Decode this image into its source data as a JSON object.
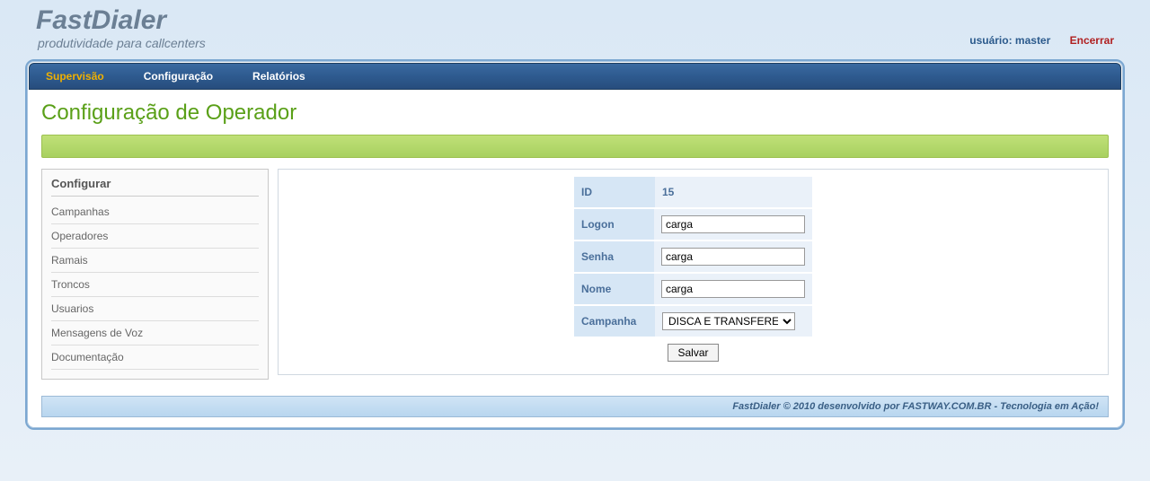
{
  "brand": {
    "title": "FastDialer",
    "subtitle": "produtividade para callcenters"
  },
  "topRight": {
    "userLabel": "usuário: master",
    "logout": "Encerrar"
  },
  "nav": {
    "items": [
      {
        "label": "Supervisão",
        "active": true
      },
      {
        "label": "Configuração",
        "active": false
      },
      {
        "label": "Relatórios",
        "active": false
      }
    ]
  },
  "pageTitle": "Configuração de Operador",
  "sidebar": {
    "heading": "Configurar",
    "items": [
      "Campanhas",
      "Operadores",
      "Ramais",
      "Troncos",
      "Usuarios",
      "Mensagens de Voz",
      "Documentação"
    ]
  },
  "form": {
    "fields": {
      "id": {
        "label": "ID",
        "value": "15"
      },
      "logon": {
        "label": "Logon",
        "value": "carga"
      },
      "senha": {
        "label": "Senha",
        "value": "carga"
      },
      "nome": {
        "label": "Nome",
        "value": "carga"
      },
      "campanha": {
        "label": "Campanha",
        "selected": "DISCA E TRANSFERE"
      }
    },
    "saveLabel": "Salvar"
  },
  "footer": "FastDialer © 2010 desenvolvido por FASTWAY.COM.BR - Tecnologia em Ação!"
}
